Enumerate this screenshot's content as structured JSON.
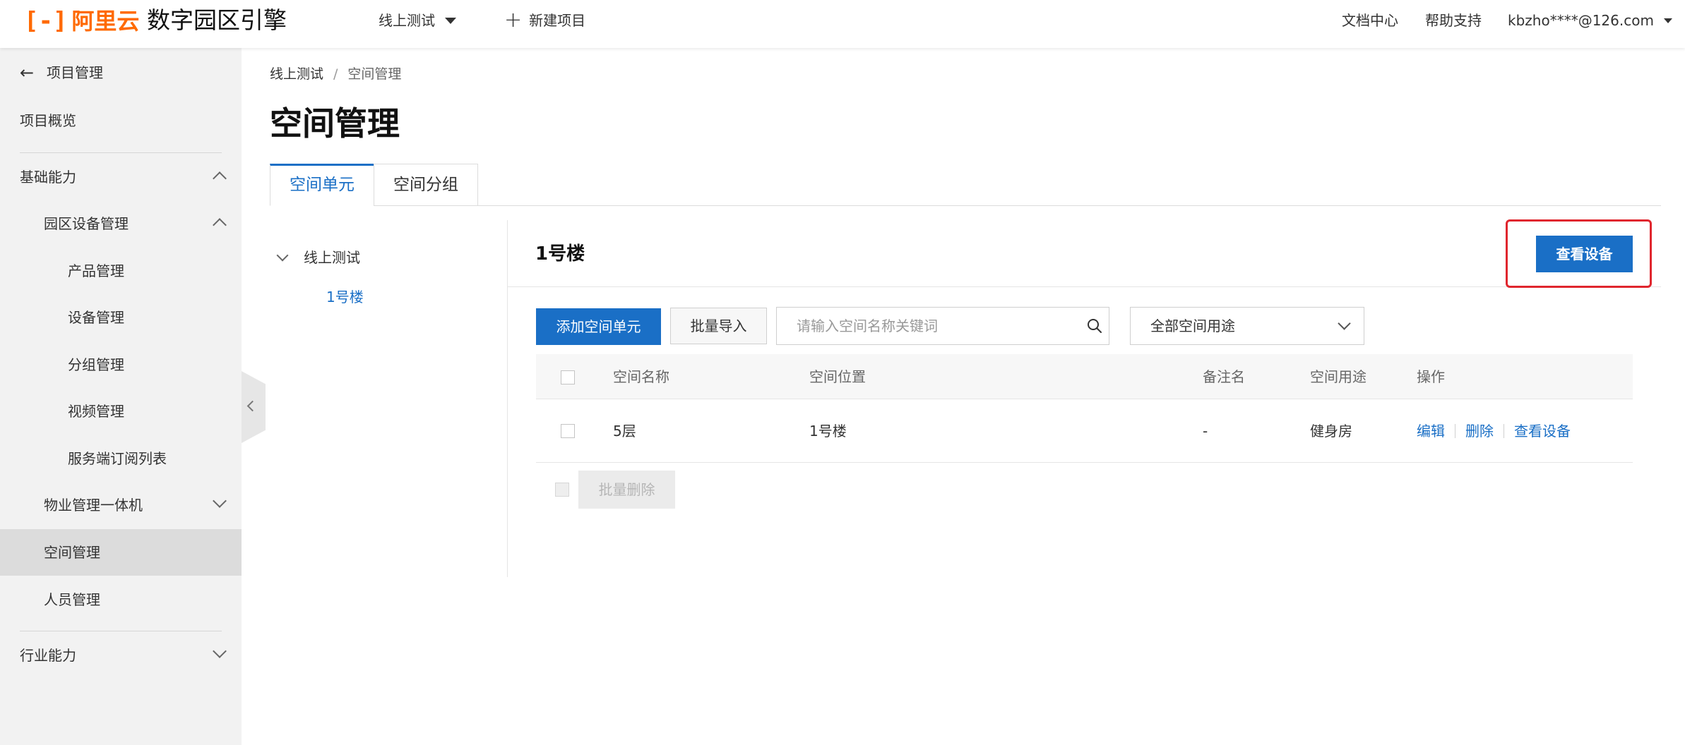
{
  "topbar": {
    "logo_bracket": "[-]",
    "logo_text": "阿里云",
    "product_name": "数字园区引擎",
    "project_select": "线上测试",
    "new_project": "新建项目",
    "links": [
      "文档中心",
      "帮助支持"
    ],
    "account": "kbzho****@126.com"
  },
  "sidebar": {
    "back_label": "项目管理",
    "items": [
      {
        "label": "项目概览"
      },
      {
        "label": "基础能力",
        "expanded": true
      },
      {
        "label": "园区设备管理",
        "expanded": true
      },
      {
        "label": "产品管理"
      },
      {
        "label": "设备管理"
      },
      {
        "label": "分组管理"
      },
      {
        "label": "视频管理"
      },
      {
        "label": "服务端订阅列表"
      },
      {
        "label": "物业管理一体机",
        "expanded": false
      },
      {
        "label": "空间管理",
        "active": true
      },
      {
        "label": "人员管理"
      },
      {
        "label": "行业能力",
        "expanded": false
      }
    ]
  },
  "breadcrumb": {
    "parent": "线上测试",
    "separator": "/",
    "current": "空间管理"
  },
  "page_title": "空间管理",
  "tabs": [
    {
      "label": "空间单元",
      "active": true
    },
    {
      "label": "空间分组",
      "active": false
    }
  ],
  "tree": {
    "root": "线上测试",
    "child": "1号楼"
  },
  "panel": {
    "title": "1号楼",
    "view_devices_button": "查看设备",
    "add_button": "添加空间单元",
    "import_button": "批量导入",
    "search_placeholder": "请输入空间名称关键词",
    "filter_value": "全部空间用途",
    "batch_delete_button": "批量删除"
  },
  "table": {
    "headers": [
      "空间名称",
      "空间位置",
      "备注名",
      "空间用途",
      "操作"
    ],
    "rows": [
      {
        "name": "5层",
        "location": "1号楼",
        "remark": "-",
        "usage": "健身房",
        "actions": [
          "编辑",
          "删除",
          "查看设备"
        ]
      }
    ]
  },
  "colors": {
    "accent": "#1a6fc6",
    "brand": "#ff6a00",
    "highlight": "#e0262e",
    "sidebar_bg": "#f2f2f2"
  }
}
